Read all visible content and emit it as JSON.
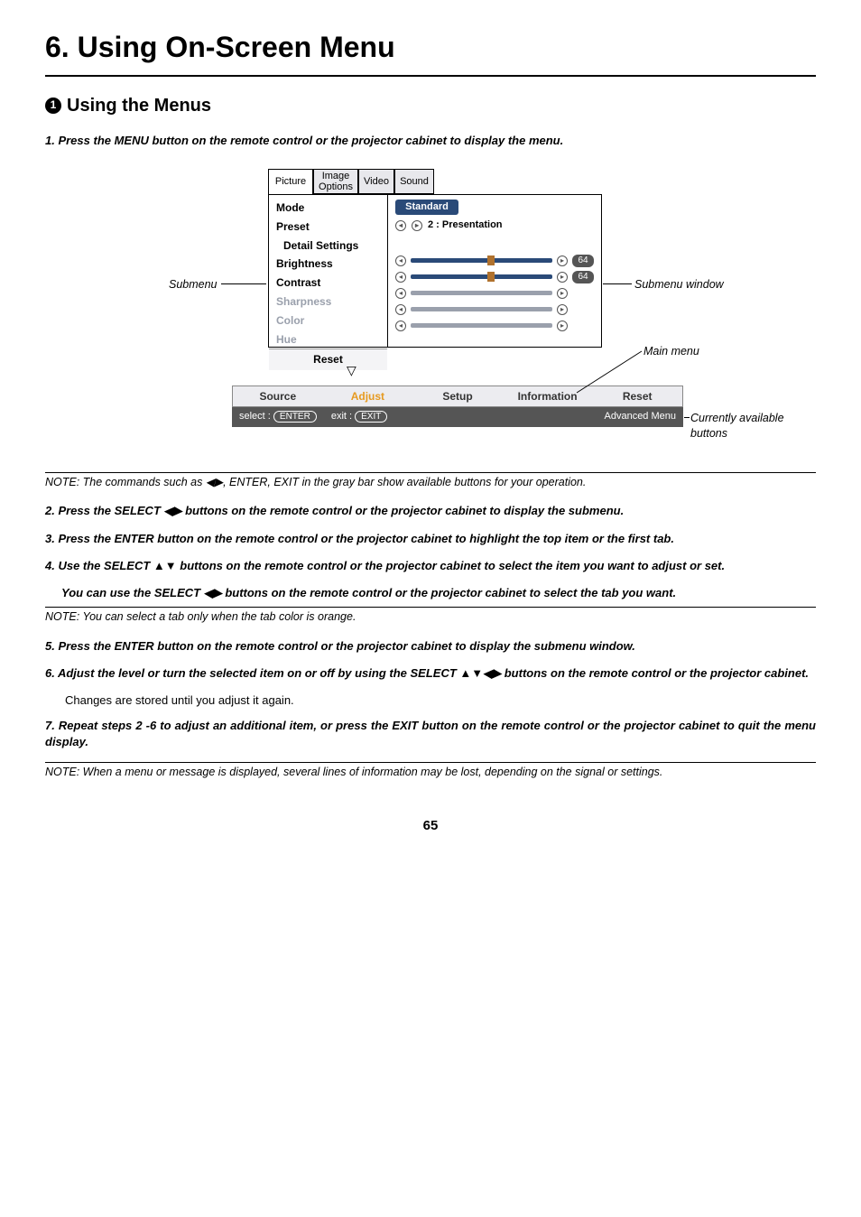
{
  "chapter_title": "6. Using On-Screen Menu",
  "section": {
    "num": "1",
    "title": "Using the Menus"
  },
  "steps": {
    "s1": "1.  Press the MENU button on the remote control or the projector cabinet to display the menu.",
    "s2": "2.  Press the SELECT ◀▶ buttons on the remote control or the projector cabinet to display the submenu.",
    "s3": "3.  Press the ENTER button on the remote control or the projector cabinet to highlight the top item or the first tab.",
    "s4a": "4.  Use the SELECT ▲▼ buttons on the remote control or the projector cabinet to select the item you want to adjust or set.",
    "s4b": "You can use the SELECT ◀▶ buttons on the remote control or the projector cabinet to select the tab you want.",
    "s5": "5.  Press the ENTER button on the remote control or the projector cabinet to display the submenu window.",
    "s6": "6.  Adjust the level or turn the selected item on or off by using the SELECT ▲▼◀▶ buttons on the remote control or the projector cabinet.",
    "s6b": "Changes are stored until you adjust it again.",
    "s7": "7.  Repeat steps 2 -6 to adjust an additional item, or press the EXIT button on the remote control or the projector cabinet to quit the menu display."
  },
  "notes": {
    "n1": "NOTE: The commands such as ◀▶, ENTER, EXIT in the gray bar show available buttons for your operation.",
    "n2": "NOTE: You can select a tab only when the tab color is orange.",
    "n3": "NOTE: When a menu or message is displayed, several lines of information may be lost, depending on the signal or settings."
  },
  "osd": {
    "tabs": {
      "picture": "Picture",
      "image_options": "Image Options",
      "video": "Video",
      "sound": "Sound"
    },
    "submenu": {
      "mode": "Mode",
      "preset": "Preset",
      "detail": "Detail Settings",
      "brightness": "Brightness",
      "contrast": "Contrast",
      "sharpness": "Sharpness",
      "color": "Color",
      "hue": "Hue",
      "reset": "Reset"
    },
    "values": {
      "mode": "Standard",
      "preset": "2 : Presentation",
      "brightness": "64",
      "contrast": "64"
    },
    "main": {
      "source": "Source",
      "adjust": "Adjust",
      "setup": "Setup",
      "information": "Information",
      "reset": "Reset"
    },
    "status": {
      "select": "select :",
      "enter": "ENTER",
      "exit": "exit :",
      "exit_btn": "EXIT",
      "advanced": "Advanced Menu"
    }
  },
  "callouts": {
    "submenu": "Submenu",
    "submenu_window": "Submenu window",
    "main_menu": "Main menu",
    "available": "Currently available buttons"
  },
  "page_number": "65"
}
